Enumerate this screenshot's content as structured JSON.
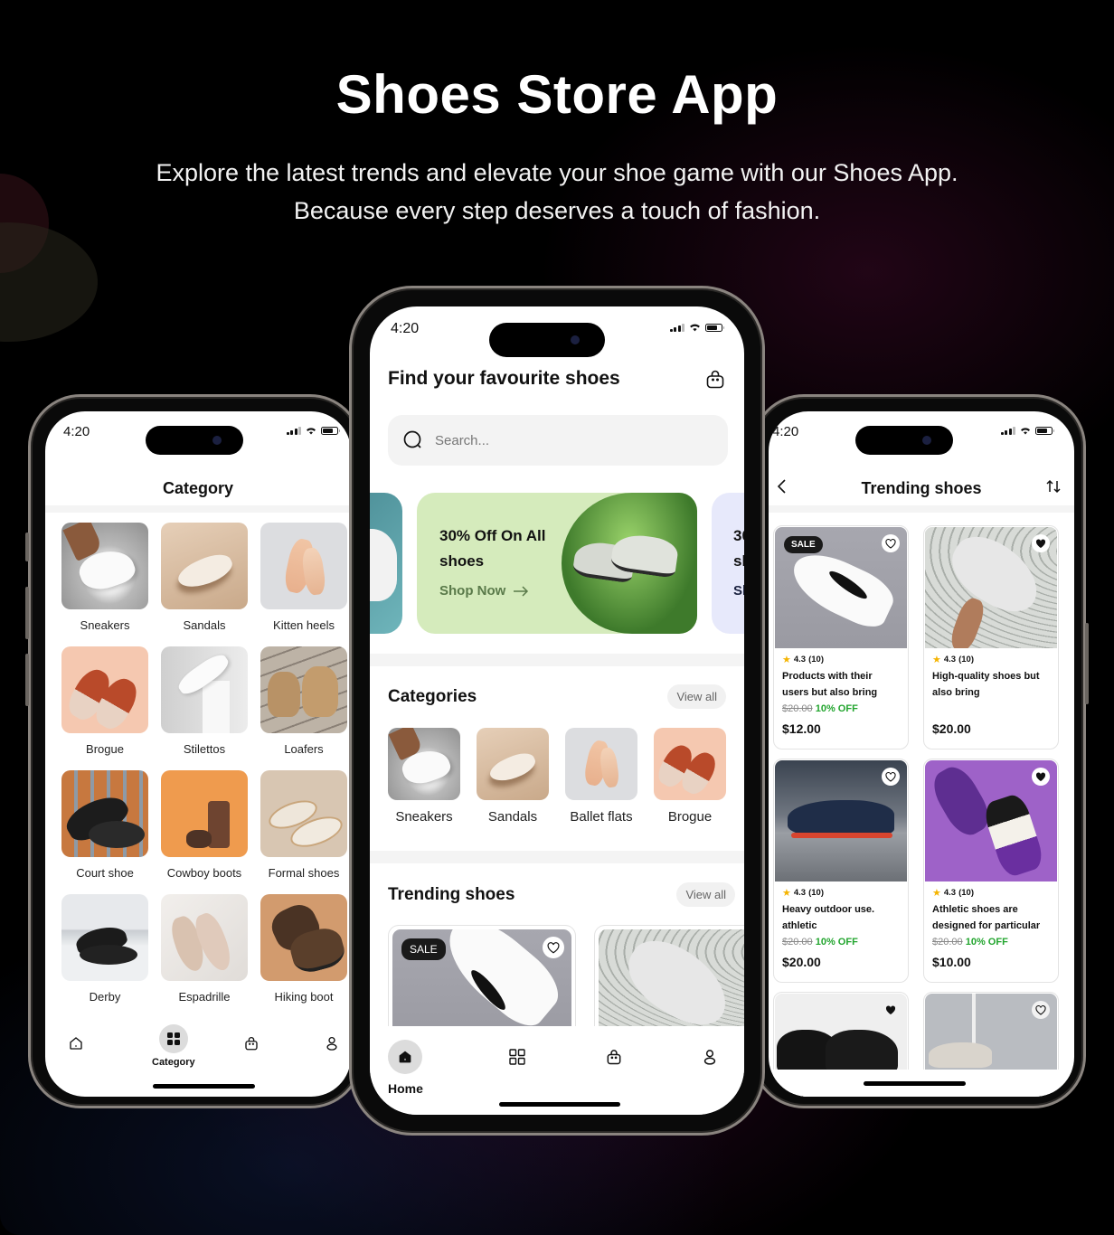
{
  "hero": {
    "title": "Shoes Store App",
    "subtitle": "Explore the latest trends and elevate your shoe game with our Shoes App. Because every step deserves a touch of fashion."
  },
  "status_bar": {
    "time": "4:20"
  },
  "category_screen": {
    "title": "Category",
    "items": [
      {
        "label": "Sneakers"
      },
      {
        "label": "Sandals"
      },
      {
        "label": "Kitten heels"
      },
      {
        "label": "Brogue"
      },
      {
        "label": "Stilettos"
      },
      {
        "label": "Loafers"
      },
      {
        "label": "Court shoe"
      },
      {
        "label": "Cowboy boots"
      },
      {
        "label": "Formal shoes"
      },
      {
        "label": "Derby"
      },
      {
        "label": "Espadrille"
      },
      {
        "label": "Hiking boot"
      }
    ],
    "tabbar": {
      "items": [
        {
          "icon": "home-icon",
          "label": ""
        },
        {
          "icon": "grid-icon",
          "label": "Category",
          "active": true
        },
        {
          "icon": "bag-icon",
          "label": ""
        },
        {
          "icon": "user-icon",
          "label": ""
        }
      ]
    }
  },
  "home_screen": {
    "title": "Find your favourite shoes",
    "search": {
      "placeholder": "Search..."
    },
    "banners": [
      {
        "title": "30% Off On All shoes",
        "cta": "Shop Now",
        "bg": "#d5ebbc"
      },
      {
        "title_partial": "30\nsh",
        "cta_partial": "Sh",
        "bg": "#e7e9fb"
      }
    ],
    "categories": {
      "heading": "Categories",
      "view_all": "View all",
      "items": [
        {
          "label": "Sneakers"
        },
        {
          "label": "Sandals"
        },
        {
          "label": "Ballet flats"
        },
        {
          "label": "Brogue"
        }
      ]
    },
    "trending": {
      "heading": "Trending shoes",
      "view_all": "View all",
      "cards": [
        {
          "badge": "SALE",
          "favorite": false
        },
        {
          "favorite": null
        }
      ]
    },
    "tabbar": {
      "items": [
        {
          "icon": "home-icon",
          "label": "Home",
          "active": true
        },
        {
          "icon": "grid-icon",
          "label": ""
        },
        {
          "icon": "bag-icon",
          "label": ""
        },
        {
          "icon": "user-icon",
          "label": ""
        }
      ]
    }
  },
  "trending_screen": {
    "title": "Trending shoes",
    "products": [
      {
        "badge": "SALE",
        "favorite": false,
        "rating": "4.3",
        "reviews": "(10)",
        "name": "Products with their users but also bring",
        "old_price": "$20.00",
        "discount": "10% OFF",
        "price": "$12.00"
      },
      {
        "favorite": true,
        "rating": "4.3",
        "reviews": "(10)",
        "name": "High-quality shoes but also bring",
        "old_price": "",
        "discount": "",
        "price": "$20.00"
      },
      {
        "favorite": false,
        "rating": "4.3",
        "reviews": "(10)",
        "name": "Heavy outdoor use. athletic",
        "old_price": "$20.00",
        "discount": "10% OFF",
        "price": "$20.00"
      },
      {
        "favorite": true,
        "rating": "4.3",
        "reviews": "(10)",
        "name": "Athletic shoes are designed for particular",
        "old_price": "$20.00",
        "discount": "10% OFF",
        "price": "$10.00"
      },
      {
        "favorite": true
      },
      {
        "favorite": false
      }
    ]
  },
  "colors": {
    "accent_green": "#22a52e",
    "banner_green": "#d5ebbc",
    "rating_star": "#f5b400"
  }
}
